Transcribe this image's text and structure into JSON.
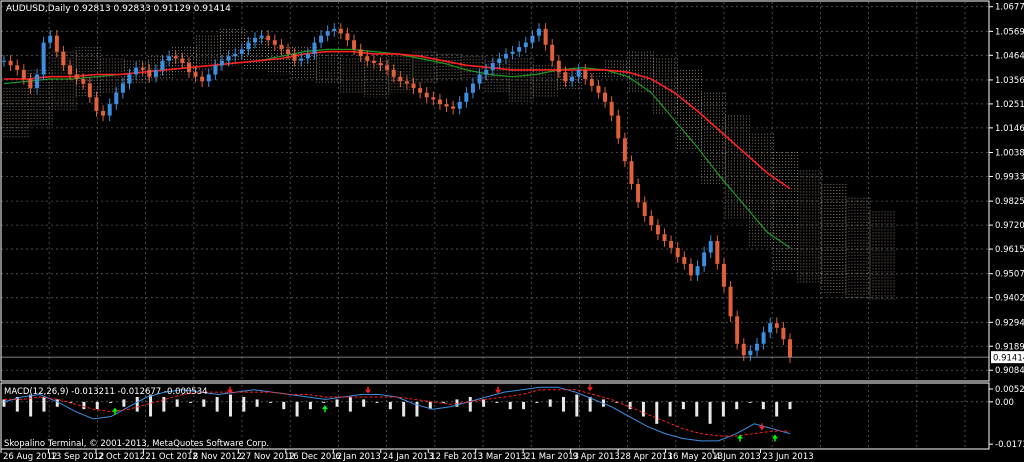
{
  "window": {
    "symbol_line": "AUDUSD,Daily  0.92813 0.92833 0.91129 0.91414"
  },
  "indicator": {
    "macd_line": "MACD(12,26,9) -0.013211 -0.012677 -0.000534"
  },
  "footer": {
    "copyright": "Skopalino Terminal, © 2001-2013, MetaQuotes Software Corp."
  },
  "colors": {
    "background": "#000000",
    "grid": "#5a5a5a",
    "bull_candle": "#3a8fe0",
    "bear_candle": "#e0603a",
    "ma_fast": "#1f9a1f",
    "ma_slow": "#ff2020",
    "cloud": "#f0d8c8",
    "macd_hist": "#e8e8e8",
    "signal_up": "#00ff00",
    "signal_down": "#ff2020"
  },
  "chart_data": {
    "type": "line",
    "title": "AUDUSD,Daily",
    "price_axis_labels": [
      "1.06770",
      "1.05690",
      "1.04640",
      "1.03560",
      "1.02510",
      "1.01460",
      "1.00380",
      "0.99330",
      "0.98250",
      "0.97200",
      "0.96150",
      "0.95070",
      "0.94020",
      "0.92940",
      "0.91890",
      "0.90840"
    ],
    "current_price": "0.91414",
    "macd_axis_labels": [
      "0.005285",
      "0.00",
      "-0.01734"
    ],
    "date_labels": [
      "26 Aug 2012",
      "13 Sep 2012",
      "2 Oct 2012",
      "21 Oct 2012",
      "8 Nov 2012",
      "27 Nov 2012",
      "16 Dec 2012",
      "6 Jan 2013",
      "24 Jan 2013",
      "12 Feb 2013",
      "3 Mar 2013",
      "21 Mar 2013",
      "9 Apr 2013",
      "28 Apr 2013",
      "16 May 2013",
      "4 Jun 2013",
      "23 Jun 2013"
    ],
    "ylim": [
      0.905,
      1.068
    ],
    "close_path": [
      1.044,
      1.042,
      1.04,
      1.036,
      1.032,
      1.038,
      1.052,
      1.055,
      1.048,
      1.042,
      1.038,
      1.036,
      1.034,
      1.028,
      1.022,
      1.02,
      1.025,
      1.03,
      1.034,
      1.038,
      1.041,
      1.04,
      1.037,
      1.04,
      1.044,
      1.046,
      1.045,
      1.043,
      1.039,
      1.037,
      1.035,
      1.038,
      1.042,
      1.044,
      1.046,
      1.047,
      1.049,
      1.052,
      1.054,
      1.055,
      1.053,
      1.051,
      1.049,
      1.047,
      1.044,
      1.045,
      1.047,
      1.052,
      1.055,
      1.057,
      1.058,
      1.056,
      1.053,
      1.049,
      1.046,
      1.044,
      1.043,
      1.042,
      1.04,
      1.037,
      1.035,
      1.034,
      1.032,
      1.03,
      1.028,
      1.027,
      1.025,
      1.024,
      1.023,
      1.026,
      1.03,
      1.034,
      1.038,
      1.04,
      1.043,
      1.045,
      1.047,
      1.048,
      1.05,
      1.052,
      1.055,
      1.058,
      1.051,
      1.044,
      1.039,
      1.035,
      1.037,
      1.04,
      1.036,
      1.033,
      1.03,
      1.026,
      1.02,
      1.01,
      1.0,
      0.99,
      0.982,
      0.976,
      0.972,
      0.968,
      0.965,
      0.962,
      0.958,
      0.955,
      0.95,
      0.954,
      0.96,
      0.965,
      0.955,
      0.945,
      0.932,
      0.92,
      0.915,
      0.917,
      0.92,
      0.925,
      0.929,
      0.927,
      0.922,
      0.914
    ],
    "ma_fast_path": [
      1.034,
      1.035,
      1.036,
      1.036,
      1.037,
      1.038,
      1.039,
      1.04,
      1.041,
      1.042,
      1.043,
      1.044,
      1.046,
      1.048,
      1.049,
      1.049,
      1.048,
      1.047,
      1.045,
      1.043,
      1.04,
      1.038,
      1.037,
      1.038,
      1.04,
      1.041,
      1.04,
      1.037,
      1.03,
      1.018,
      1.006,
      0.993,
      0.981,
      0.969,
      0.962
    ],
    "ma_slow_path": [
      1.036,
      1.036,
      1.037,
      1.037,
      1.038,
      1.038,
      1.039,
      1.04,
      1.041,
      1.042,
      1.043,
      1.044,
      1.045,
      1.047,
      1.048,
      1.048,
      1.047,
      1.047,
      1.046,
      1.044,
      1.042,
      1.041,
      1.04,
      1.04,
      1.04,
      1.04,
      1.04,
      1.039,
      1.036,
      1.03,
      1.022,
      1.013,
      1.004,
      0.995,
      0.988
    ],
    "cloud_upper": [
      1.032,
      1.04,
      1.048,
      1.05,
      1.045,
      1.044,
      1.046,
      1.05,
      1.055,
      1.058,
      1.054,
      1.05,
      1.05,
      1.048,
      1.045,
      1.044,
      1.046,
      1.048,
      1.047,
      1.046,
      1.044,
      1.045,
      1.042,
      1.04,
      1.04,
      1.044,
      1.048,
      1.045,
      1.04,
      1.03,
      1.02,
      1.012,
      1.004,
      0.996,
      0.99,
      0.984,
      0.978
    ],
    "cloud_lower": [
      1.01,
      1.015,
      1.022,
      1.028,
      1.03,
      1.034,
      1.036,
      1.038,
      1.04,
      1.042,
      1.04,
      1.038,
      1.036,
      1.034,
      1.03,
      1.028,
      1.03,
      1.034,
      1.036,
      1.036,
      1.03,
      1.026,
      1.028,
      1.031,
      1.036,
      1.036,
      1.03,
      1.02,
      1.005,
      0.99,
      0.975,
      0.962,
      0.952,
      0.946,
      0.942,
      0.94,
      0.939
    ],
    "macd_hist": [
      0.001,
      0.002,
      0.003,
      0.002,
      0.001,
      0.0,
      -0.001,
      -0.001,
      0.0,
      0.001,
      0.002,
      0.003,
      0.002,
      0.001,
      0.0,
      0.001,
      0.002,
      0.003,
      0.002,
      0.001,
      0.0,
      -0.001,
      -0.002,
      -0.001,
      0.0,
      0.001,
      0.002,
      0.001,
      0.0,
      -0.001,
      -0.002,
      -0.002,
      -0.001,
      0.0,
      0.001,
      0.002,
      0.001,
      0.0,
      -0.001,
      -0.001,
      0.0,
      0.001,
      0.002,
      0.003,
      0.002,
      0.001,
      0.0,
      -0.001,
      -0.002,
      -0.003,
      -0.002,
      -0.001,
      -0.002,
      -0.003,
      -0.002,
      -0.001,
      0.0,
      -0.001,
      -0.002,
      -0.001
    ],
    "macd_main": [
      0.0,
      0.002,
      0.003,
      0.0,
      -0.004,
      -0.007,
      -0.006,
      -0.002,
      0.002,
      0.004,
      0.005,
      0.004,
      0.003,
      0.004,
      0.005,
      0.004,
      0.003,
      0.002,
      0.001,
      0.002,
      0.003,
      0.003,
      0.002,
      -0.001,
      -0.003,
      -0.002,
      0.0,
      0.002,
      0.004,
      0.005,
      0.006,
      0.006,
      0.004,
      0.001,
      -0.002,
      -0.006,
      -0.01,
      -0.013,
      -0.015,
      -0.016,
      -0.016,
      -0.013,
      -0.009,
      -0.011,
      -0.013
    ],
    "macd_signal": [
      0.001,
      0.001,
      0.002,
      0.001,
      -0.001,
      -0.003,
      -0.004,
      -0.003,
      -0.001,
      0.001,
      0.003,
      0.004,
      0.004,
      0.004,
      0.004,
      0.004,
      0.003,
      0.003,
      0.002,
      0.002,
      0.002,
      0.002,
      0.002,
      0.001,
      0.0,
      -0.001,
      0.0,
      0.001,
      0.002,
      0.003,
      0.005,
      0.005,
      0.005,
      0.003,
      0.001,
      -0.002,
      -0.005,
      -0.008,
      -0.011,
      -0.013,
      -0.014,
      -0.014,
      -0.013,
      -0.012,
      -0.012
    ]
  }
}
